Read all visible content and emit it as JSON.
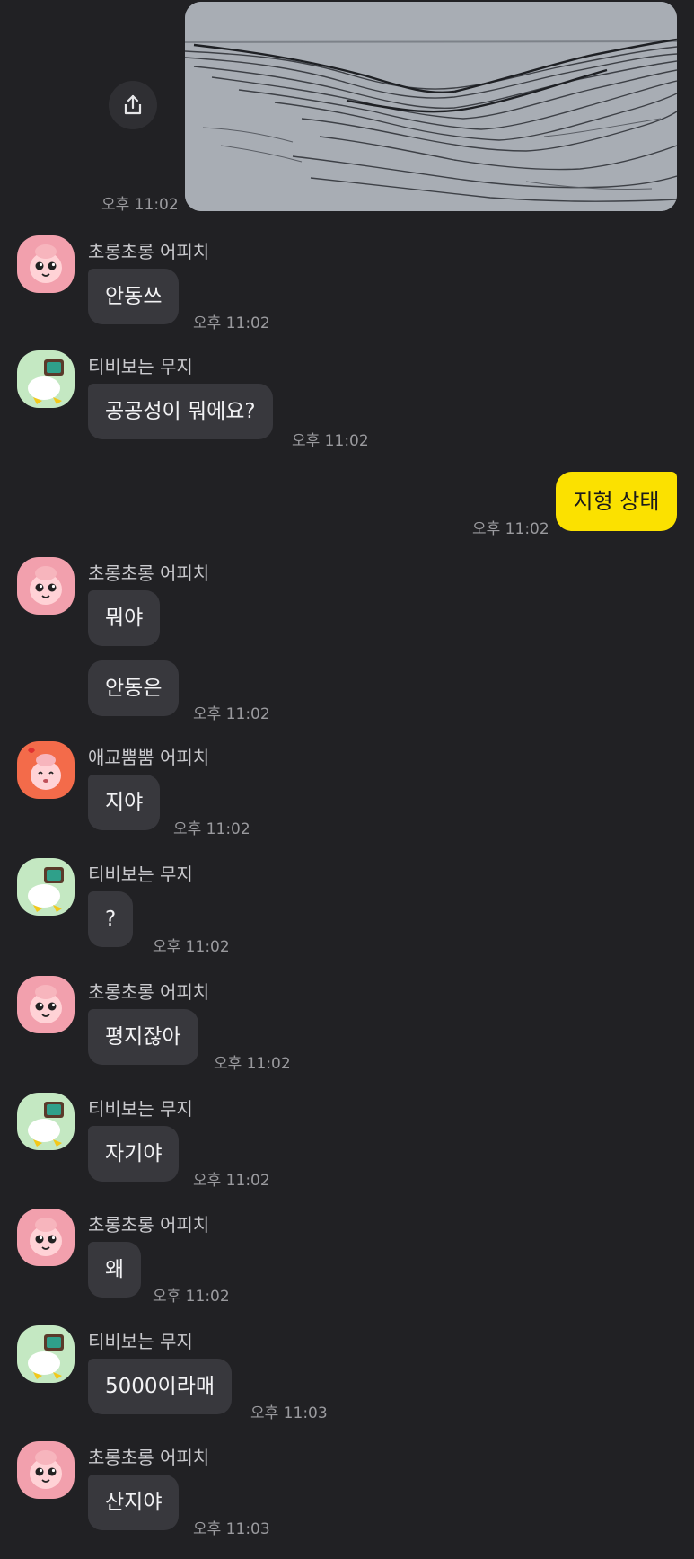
{
  "image_message": {
    "time": "오후 11:02",
    "share_icon": "share-icon"
  },
  "outgoing": {
    "text": "지형 상태",
    "time": "오후 11:02",
    "bubble_color": "#FBE100"
  },
  "senders": {
    "peach": "초롱초롱 어피치",
    "muzi": "티비보는 무지",
    "peach_aegyo": "애교뿜뿜 어피치"
  },
  "messages": [
    {
      "sender": "초롱초롱 어피치",
      "lines": [
        "안동쓰"
      ],
      "time": "오후 11:02"
    },
    {
      "sender": "티비보는 무지",
      "lines": [
        "공공성이 뭐에요?"
      ],
      "time": "오후 11:02"
    },
    {
      "sender": "초롱초롱 어피치",
      "lines": [
        "뭐야",
        "안동은"
      ],
      "time": "오후 11:02"
    },
    {
      "sender": "애교뿜뿜 어피치",
      "lines": [
        "지야"
      ],
      "time": "오후 11:02"
    },
    {
      "sender": "티비보는 무지",
      "lines": [
        "?"
      ],
      "time": "오후 11:02"
    },
    {
      "sender": "초롱초롱 어피치",
      "lines": [
        "평지잖아"
      ],
      "time": "오후 11:02"
    },
    {
      "sender": "티비보는 무지",
      "lines": [
        "자기야"
      ],
      "time": "오후 11:02"
    },
    {
      "sender": "초롱초롱 어피치",
      "lines": [
        "왜"
      ],
      "time": "오후 11:02"
    },
    {
      "sender": "티비보는 무지",
      "lines": [
        "5000이라매"
      ],
      "time": "오후 11:03"
    },
    {
      "sender": "초롱초롱 어피치",
      "lines": [
        "산지야"
      ],
      "time": "오후 11:03"
    }
  ],
  "colors": {
    "background": "#212124",
    "incoming_bubble": "#38383D",
    "timestamp": "#9A9A9E"
  }
}
